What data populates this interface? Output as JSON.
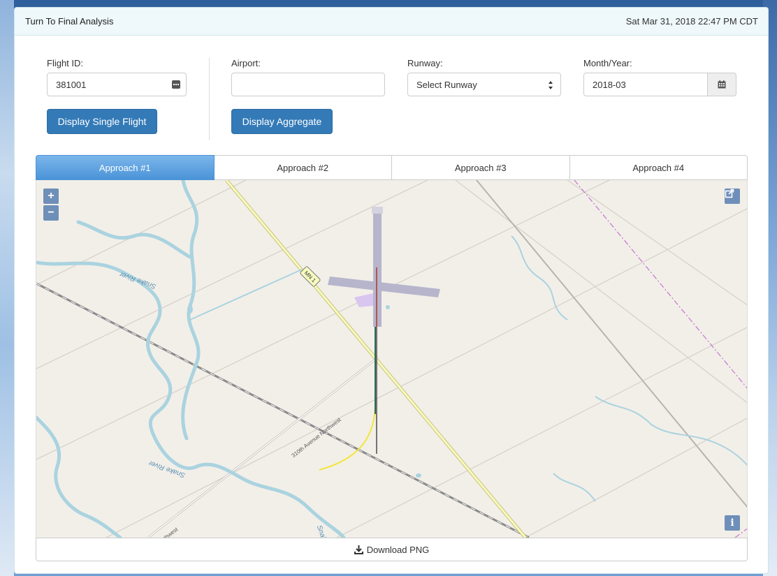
{
  "header": {
    "title": "Turn To Final Analysis",
    "datetime": "Sat Mar 31, 2018 22:47 PM CDT"
  },
  "form": {
    "flight_id": {
      "label": "Flight ID:",
      "value": "381001",
      "icon": "ellipsis-icon"
    },
    "airport": {
      "label": "Airport:",
      "value": ""
    },
    "runway": {
      "label": "Runway:",
      "selected": "Select Runway"
    },
    "month_year": {
      "label": "Month/Year:",
      "value": "2018-03",
      "icon": "calendar-icon"
    },
    "single_button": "Display Single Flight",
    "aggregate_button": "Display Aggregate"
  },
  "tabs": [
    {
      "label": "Approach #1",
      "active": true
    },
    {
      "label": "Approach #2",
      "active": false
    },
    {
      "label": "Approach #3",
      "active": false
    },
    {
      "label": "Approach #4",
      "active": false
    }
  ],
  "map": {
    "zoom_in": "+",
    "zoom_out": "−",
    "info": "i",
    "labels": {
      "river_1": "Snake River",
      "river_2": "Snake River",
      "road_1": "MN 1",
      "road_2": "310th Avenue Northwest",
      "road_3": "e Northwest",
      "river_3": "Snake"
    },
    "colors": {
      "background": "#f2efe9",
      "water": "#aad3df",
      "highway": "#f7fabf",
      "runway": "#b7b5cc",
      "track_yellow": "#f2e63b",
      "track_green": "#2b6a5a",
      "centerline": "#333333",
      "boundary": "#c77dcf"
    }
  },
  "download": {
    "label": "Download PNG",
    "icon": "download-icon"
  },
  "colors": {
    "primary": "#337ab7",
    "tab_active": "#4b94d8"
  }
}
